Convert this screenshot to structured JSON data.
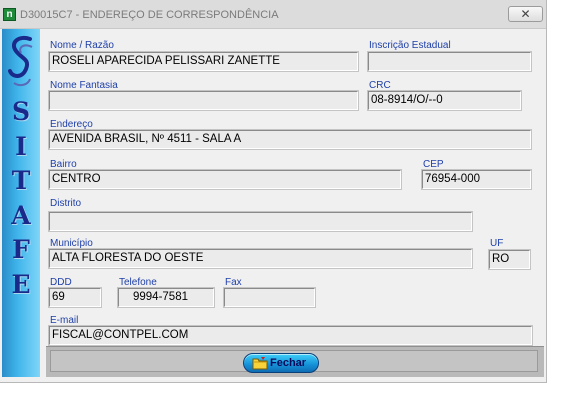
{
  "window": {
    "title": "D30015C7 - ENDEREÇO DE CORRESPONDÊNCIA",
    "close_symbol": "✕"
  },
  "banner": {
    "letters": [
      "S",
      "I",
      "T",
      "A",
      "F",
      "E"
    ]
  },
  "fields": {
    "nome": {
      "label": "Nome / Razão",
      "value": "ROSELI APARECIDA PELISSARI ZANETTE"
    },
    "inscricao": {
      "label": "Inscrição Estadual",
      "value": ""
    },
    "fantasia": {
      "label": "Nome Fantasia",
      "value": ""
    },
    "crc": {
      "label": "CRC",
      "value": "08-8914/O/--0"
    },
    "endereco": {
      "label": "Endereço",
      "value": "AVENIDA BRASIL, Nº 4511 - SALA A"
    },
    "bairro": {
      "label": "Bairro",
      "value": "CENTRO"
    },
    "cep": {
      "label": "CEP",
      "value": "76954-000"
    },
    "distrito": {
      "label": "Distrito",
      "value": ""
    },
    "municipio": {
      "label": "Município",
      "value": "ALTA FLORESTA DO OESTE"
    },
    "uf": {
      "label": "UF",
      "value": "RO"
    },
    "ddd": {
      "label": "DDD",
      "value": "69"
    },
    "telefone": {
      "label": "Telefone",
      "value": "9994-7581"
    },
    "fax": {
      "label": "Fax",
      "value": ""
    },
    "email": {
      "label": "E-mail",
      "value": "FISCAL@CONTPEL.COM"
    }
  },
  "buttons": {
    "fechar": "Fechar"
  },
  "icons": {
    "app": "app-icon",
    "close": "close-icon",
    "logo": "sitafe-logo",
    "fechar": "folder-icon"
  },
  "colors": {
    "label": "#1f3fa8",
    "banner": "#3fb4ea",
    "banner_letters": "#1a2a8a",
    "button": "#1590d8"
  }
}
